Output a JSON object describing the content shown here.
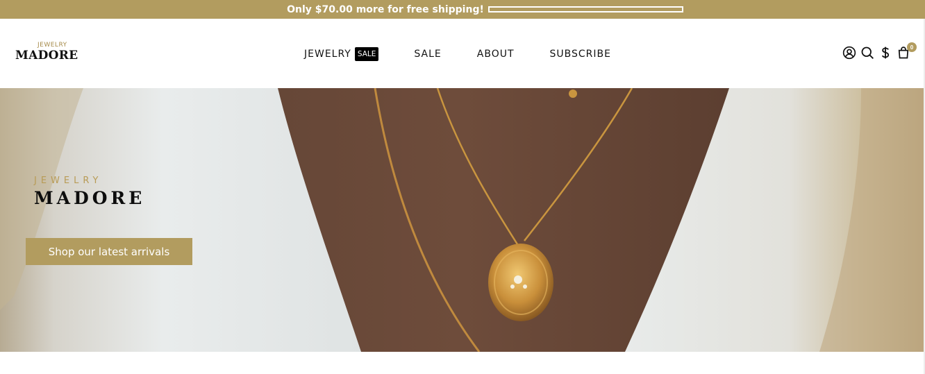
{
  "announcement": {
    "text": "Only $70.00 more for free shipping!",
    "progress_fraction": 0.0
  },
  "header": {
    "logo": {
      "small": "JEWELRY",
      "big": "MADORE"
    },
    "nav": [
      {
        "label": "JEWELRY",
        "badge": "SALE"
      },
      {
        "label": "SALE"
      },
      {
        "label": "ABOUT"
      },
      {
        "label": "SUBSCRIBE"
      }
    ],
    "icons": [
      "account-icon",
      "search-icon",
      "currency-icon",
      "cart-icon"
    ],
    "cart_count": "0"
  },
  "hero": {
    "small": "JEWELRY",
    "big": "MADORE",
    "cta": "Shop our latest arrivals"
  },
  "colors": {
    "brand_gold": "#b29c5f",
    "text_dark": "#111111",
    "white": "#ffffff"
  }
}
